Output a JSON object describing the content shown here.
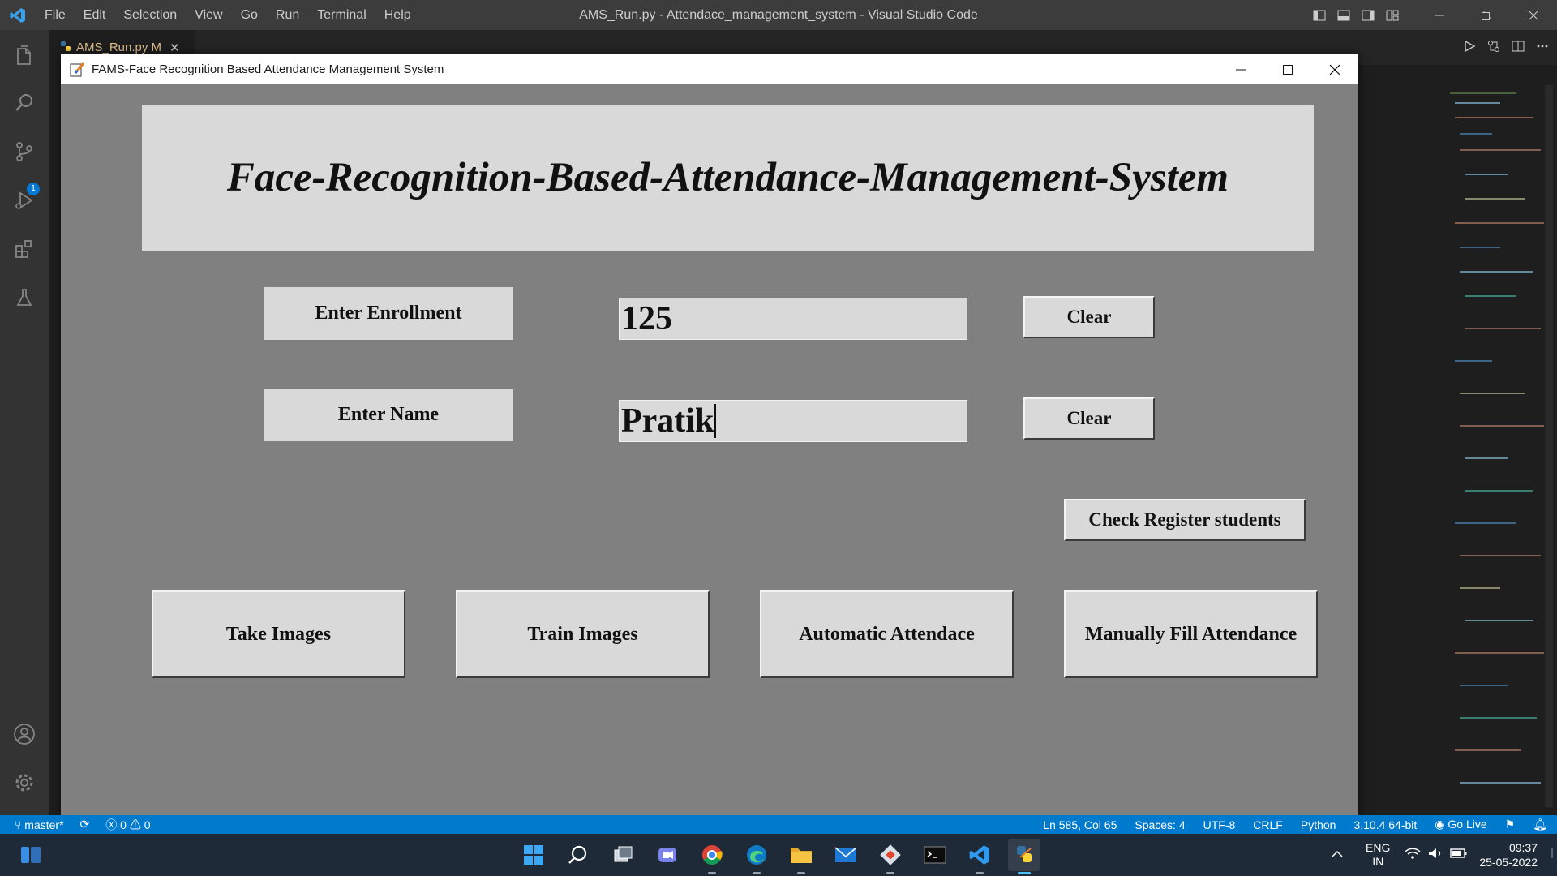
{
  "vscode": {
    "menu": [
      "File",
      "Edit",
      "Selection",
      "View",
      "Go",
      "Run",
      "Terminal",
      "Help"
    ],
    "window_title": "AMS_Run.py - Attendace_management_system - Visual Studio Code",
    "tab_label": "AMS_Run.py M",
    "source_control_badge": "1",
    "colors": {
      "titlebar": "#3c3c3c",
      "activitybar": "#333333",
      "statusbar": "#007acc"
    }
  },
  "app": {
    "window_title": "FAMS-Face Recognition Based Attendance Management System",
    "heading": "Face-Recognition-Based-Attendance-Management-System",
    "enrollment_label": "Enter Enrollment",
    "enrollment_value": "125",
    "name_label": "Enter Name",
    "name_value": "Pratik",
    "clear_label": "Clear",
    "check_register_label": "Check Register students",
    "take_images_label": "Take Images",
    "train_images_label": "Train Images",
    "automatic_attendance_label": "Automatic Attendace",
    "manual_attendance_label": "Manually Fill Attendance",
    "colors": {
      "background": "#808080",
      "widget": "#d9d9d9"
    }
  },
  "statusbar": {
    "branch": "master*",
    "problems": "ⓧ 0 ⚠ 0",
    "position": "Ln 585, Col 65",
    "spaces": "Spaces: 4",
    "encoding": "UTF-8",
    "eol": "CRLF",
    "language": "Python",
    "interpreter": "3.10.4 64-bit",
    "go_live": "Go Live"
  },
  "taskbar": {
    "lang_line1": "ENG",
    "lang_line2": "IN",
    "time": "09:37",
    "date": "25-05-2022"
  }
}
